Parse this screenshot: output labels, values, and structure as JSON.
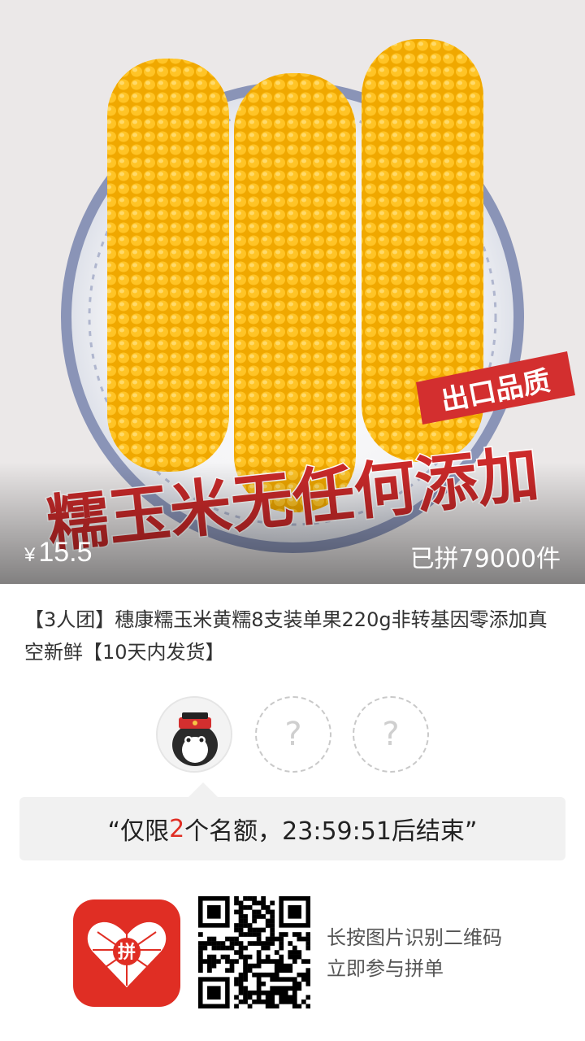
{
  "hero": {
    "badge_text": "出口品质",
    "slogan_text": "糯玉米无任何添加",
    "price_symbol": "¥",
    "price": "15.5",
    "sold_text": "已拼79000件"
  },
  "product": {
    "title": "【3人团】穗康糯玉米黄糯8支装单果220g非转基因零添加真空新鲜【10天内发货】"
  },
  "group": {
    "slots": [
      "?",
      "?"
    ],
    "notice_prefix": "“仅限",
    "notice_count": "2",
    "notice_suffix": "个名额，23:59:51后结束”"
  },
  "footer": {
    "logo_text": "拼",
    "line1": "长按图片识别二维码",
    "line2": "立即参与拼单"
  },
  "colors": {
    "accent_red": "#e02e24",
    "corn_yellow": "#f6b412"
  }
}
